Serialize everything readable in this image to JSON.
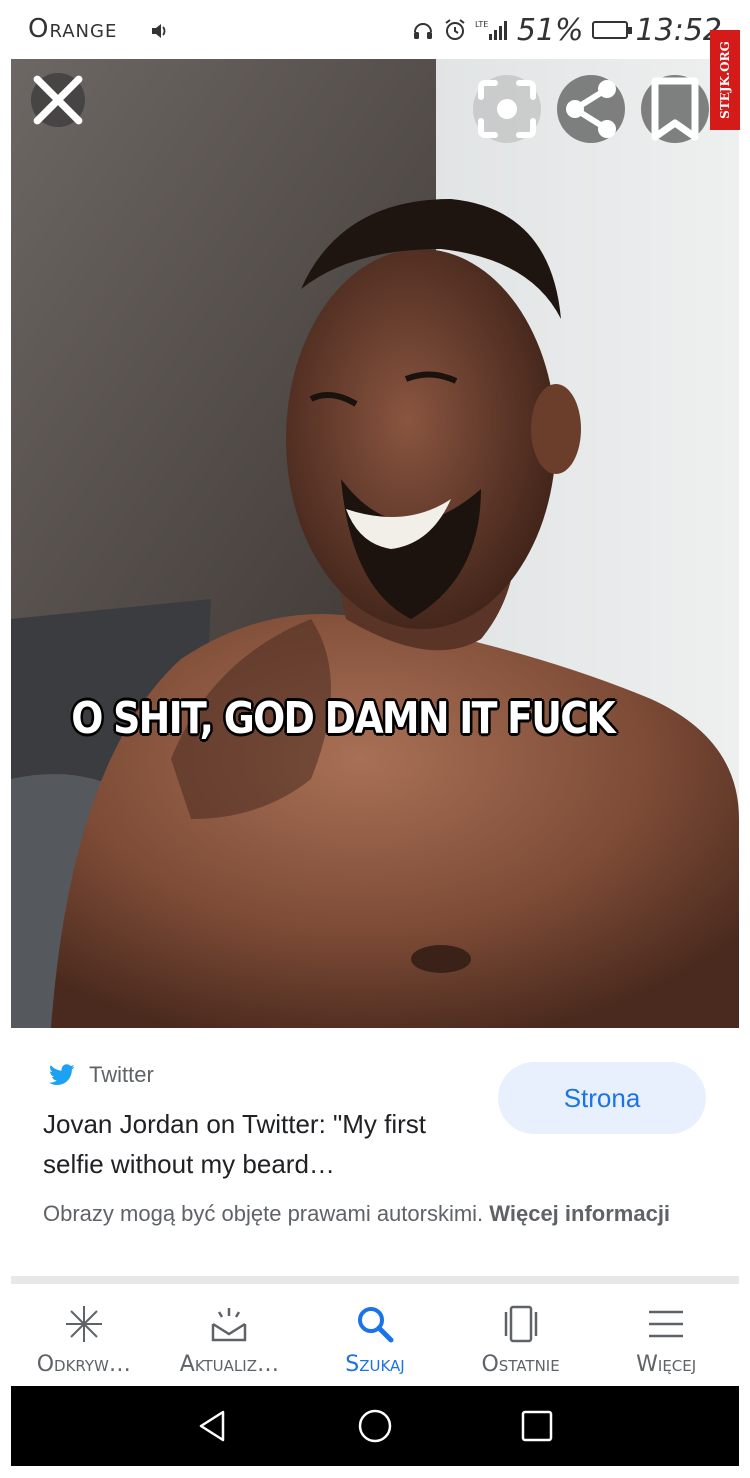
{
  "status_bar": {
    "carrier": "Orange",
    "battery_percent": "51%",
    "time": "13:52",
    "icons": [
      "sound-icon",
      "headphones-icon",
      "alarm-icon",
      "lte-signal-icon",
      "battery-charging-icon"
    ]
  },
  "watermark": {
    "text": "STEJK.ORG"
  },
  "viewer": {
    "close_icon": "close-icon",
    "lens_icon": "lens-icon",
    "share_icon": "share-icon",
    "save_icon": "bookmark-icon",
    "caption": "O SHIT, GOD DAMN IT FUCK"
  },
  "result": {
    "source": "Twitter",
    "source_icon": "twitter-bird-icon",
    "title": "Jovan Jordan on Twitter: \"My first selfie without my beard…",
    "visit_button": "Strona",
    "copyright_text": "Obrazy mogą być objęte prawami autorskimi.",
    "copyright_link": "Więcej informacji"
  },
  "bottom_nav": {
    "items": [
      {
        "label": "Odkryw…",
        "icon": "asterisk-icon",
        "active": false
      },
      {
        "label": "Aktualiz…",
        "icon": "updates-tray-icon",
        "active": false
      },
      {
        "label": "Szukaj",
        "icon": "search-icon",
        "active": true
      },
      {
        "label": "Ostatnie",
        "icon": "recent-cards-icon",
        "active": false
      },
      {
        "label": "Więcej",
        "icon": "menu-icon",
        "active": false
      }
    ]
  },
  "system_nav": {
    "icons": [
      "back-icon",
      "home-icon",
      "recents-icon"
    ]
  },
  "colors": {
    "accent": "#1a73e8",
    "twitter": "#1da1f2",
    "watermark": "#d51a1a"
  }
}
